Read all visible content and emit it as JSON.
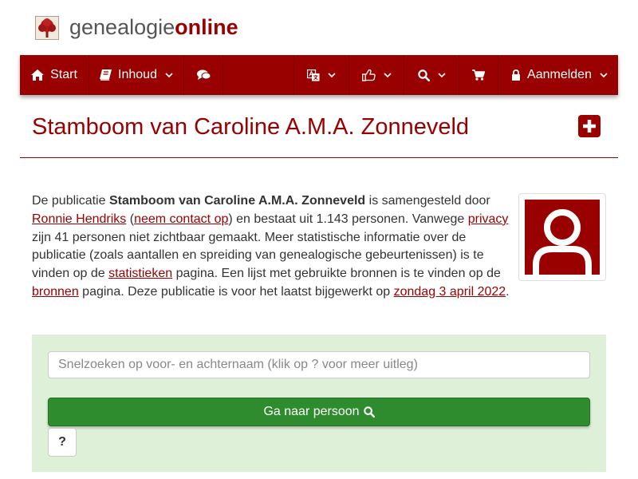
{
  "colors": {
    "brand": "#990000",
    "panel_bg": "#dff0d8",
    "success": "#2e8b2e"
  },
  "header": {
    "brand_part1": "genealogie",
    "brand_part2": "online",
    "logo_icon": "tree-logo-icon"
  },
  "navbar": {
    "items": [
      {
        "label": "Start",
        "icon": "home-icon"
      },
      {
        "label": "Inhoud",
        "icon": "book-icon",
        "dropdown": true
      },
      {
        "icon": "comments-icon"
      },
      {
        "icon": "translate-icon",
        "dropdown": true
      },
      {
        "icon": "thumbs-up-icon",
        "dropdown": true
      },
      {
        "icon": "search-icon",
        "dropdown": true
      },
      {
        "icon": "cart-icon"
      },
      {
        "label": "Aanmelden",
        "icon": "lock-icon",
        "dropdown": true
      }
    ]
  },
  "page": {
    "title": "Stamboom van Caroline A.M.A. Zonneveld",
    "add_icon": "plus-square-icon"
  },
  "description": {
    "t1": "De publicatie ",
    "pub_name": "Stamboom van Caroline A.M.A. Zonneveld",
    "t2": " is samengesteld door ",
    "author_link": "Ronnie Hendriks",
    "t3": " (",
    "contact_link": "neem contact op",
    "t4": ") en bestaat uit 1.143 personen. Vanwege ",
    "privacy_link": "privacy",
    "t5": " zijn 41 personen niet zichtbaar gemaakt. Meer statistische informatie over de publicatie (zoals aantallen en spreiding van genealogische gebeurtenissen) is te vinden op de ",
    "stats_link": "statistieken",
    "t6": " pagina. Een lijst met gebruikte bronnen is te vinden op de ",
    "sources_link": "bronnen",
    "t7": " pagina. Deze publicatie is voor het laatst bijgewerkt op ",
    "date_link": "zondag 3 april 2022",
    "t8": "."
  },
  "search": {
    "placeholder": "Snelzoeken op voor- en achternaam (klik op ? voor meer uitleg)",
    "go_label": "Ga naar persoon",
    "help_label": "?"
  }
}
